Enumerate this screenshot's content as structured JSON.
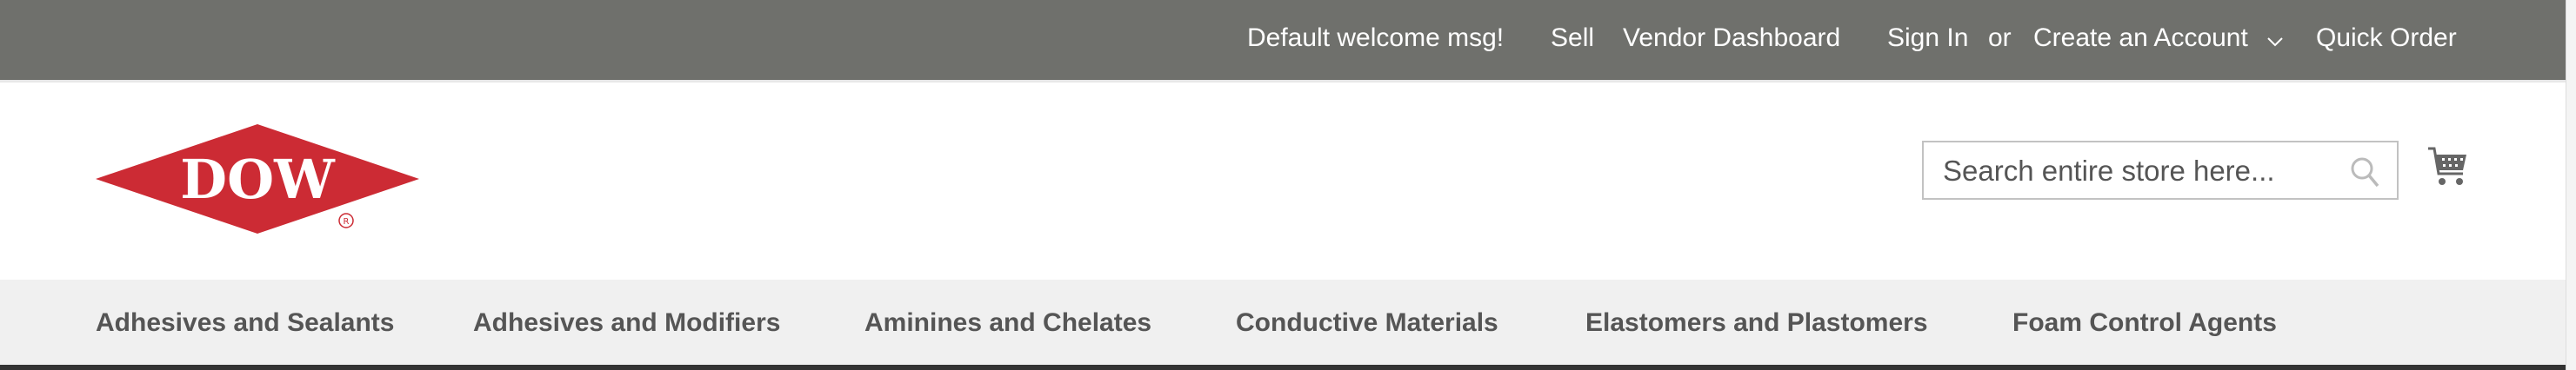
{
  "topbar": {
    "welcome": "Default welcome msg!",
    "sell": "Sell",
    "vendor_dashboard": "Vendor Dashboard",
    "sign_in": "Sign In",
    "or": "or",
    "create_account": "Create an Account",
    "quick_order": "Quick Order"
  },
  "header": {
    "logo_text": "DOW",
    "search_placeholder": "Search entire store here...",
    "cart_icon": "shopping-cart-icon",
    "search_icon": "magnifier-icon"
  },
  "nav": {
    "items": [
      {
        "label": "Adhesives and Sealants"
      },
      {
        "label": "Adhesives and Modifiers"
      },
      {
        "label": "Aminines and Chelates"
      },
      {
        "label": "Conductive Materials"
      },
      {
        "label": "Elastomers and Plastomers"
      },
      {
        "label": "Foam Control Agents"
      }
    ]
  },
  "colors": {
    "topbar": "#6f706c",
    "brand_red": "#cc2b34",
    "nav_bg": "#f0f0f0",
    "nav_text": "#555555"
  }
}
